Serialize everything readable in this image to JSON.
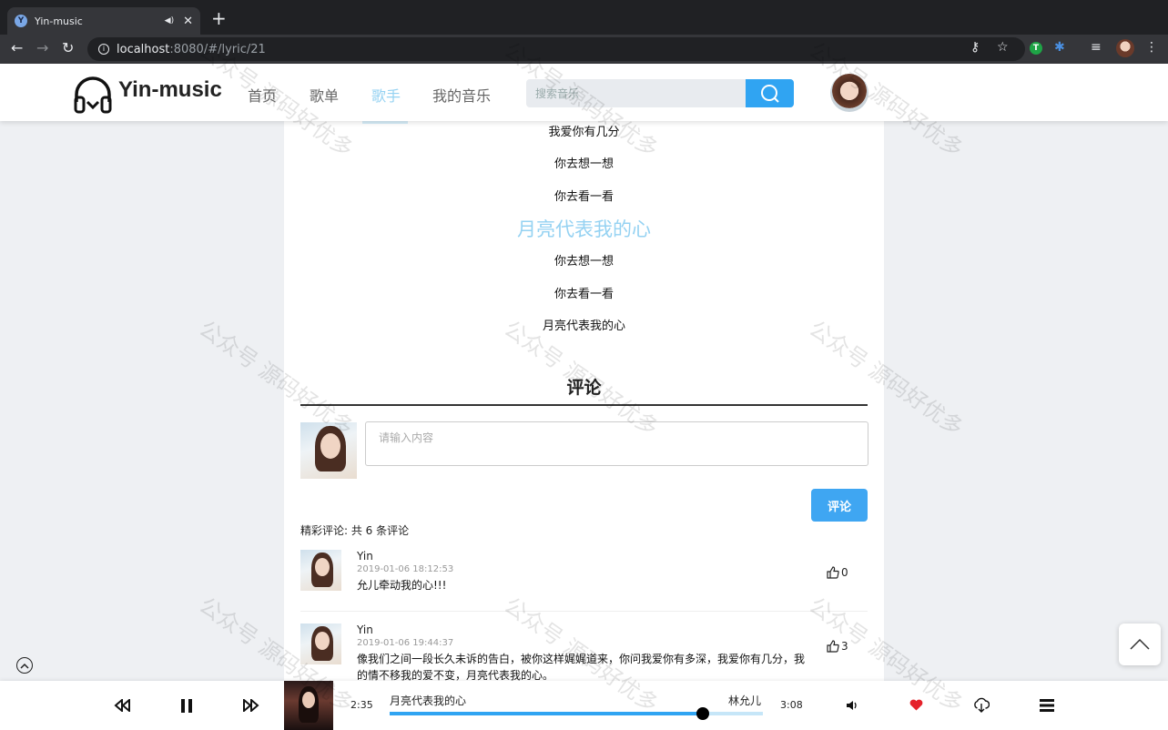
{
  "browser": {
    "tab_title": "Yin-music",
    "new_tab": "+",
    "url_host": "localhost",
    "url_rest": ":8080/#/lyric/21"
  },
  "header": {
    "logo_text": "Yin-music",
    "nav": [
      "首页",
      "歌单",
      "歌手",
      "我的音乐"
    ],
    "active_nav": "歌手",
    "search_placeholder": "搜索音乐"
  },
  "lyrics": {
    "lines": [
      "我爱你有几分",
      "你去想一想",
      "你去看一看",
      "月亮代表我的心",
      "你去想一想",
      "你去看一看",
      "月亮代表我的心"
    ],
    "current_index": 3
  },
  "comments": {
    "title": "评论",
    "input_placeholder": "请输入内容",
    "submit_label": "评论",
    "count_text": "精彩评论: 共 6 条评论",
    "items": [
      {
        "user": "Yin",
        "time": "2019-01-06 18:12:53",
        "text": "允儿牵动我的心!!!",
        "likes": "0"
      },
      {
        "user": "Yin",
        "time": "2019-01-06 19:44:37",
        "text": "像我们之间一段长久未诉的告白，被你这样娓娓道来，你问我爱你有多深，我爱你有几分，我的情不移我的爱不变，月亮代表我的心。",
        "likes": "3"
      }
    ]
  },
  "player": {
    "elapsed": "2:35",
    "total": "3:08",
    "song": "月亮代表我的心",
    "artist": "林允儿",
    "progress": 0.84
  },
  "watermark": "公众号 源码好优多",
  "colors": {
    "accent": "#30a4f2",
    "active_nav": "#95d2f2",
    "like_heart": "#e5222b"
  }
}
